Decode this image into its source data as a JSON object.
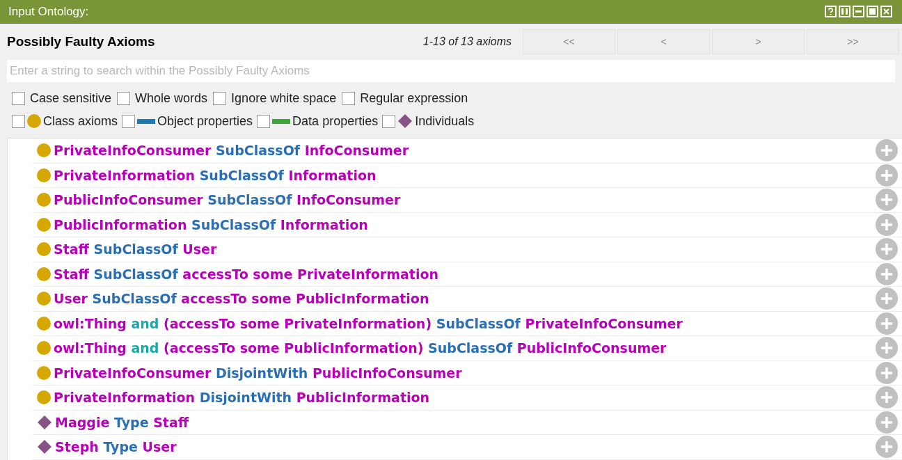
{
  "window": {
    "title": "Input Ontology:"
  },
  "header": {
    "title": "Possibly Faulty Axioms",
    "count": "1-13 of 13 axioms"
  },
  "pager": [
    {
      "label": "<<",
      "disabled": true
    },
    {
      "label": "<",
      "disabled": true
    },
    {
      "label": ">",
      "disabled": true
    },
    {
      "label": ">>",
      "disabled": true
    }
  ],
  "search": {
    "placeholder": "Enter a string to search within the Possibly Faulty Axioms"
  },
  "options": [
    {
      "label": "Case sensitive",
      "checked": false
    },
    {
      "label": "Whole words",
      "checked": false
    },
    {
      "label": "Ignore white space",
      "checked": false
    },
    {
      "label": "Regular expression",
      "checked": false
    }
  ],
  "filters": [
    {
      "label": "Class axioms",
      "kind": "class",
      "checked": false
    },
    {
      "label": "Object properties",
      "kind": "object",
      "checked": false
    },
    {
      "label": "Data properties",
      "kind": "data",
      "checked": false
    },
    {
      "label": "Individuals",
      "kind": "individual",
      "checked": false
    }
  ],
  "axioms": [
    {
      "kind": "class",
      "tokens": [
        {
          "text": "PrivateInfoConsumer",
          "kind": "entity"
        },
        {
          "text": "SubClassOf",
          "kind": "keyword"
        },
        {
          "text": "InfoConsumer",
          "kind": "entity"
        }
      ]
    },
    {
      "kind": "class",
      "tokens": [
        {
          "text": "PrivateInformation",
          "kind": "entity"
        },
        {
          "text": "SubClassOf",
          "kind": "keyword"
        },
        {
          "text": "Information",
          "kind": "entity"
        }
      ]
    },
    {
      "kind": "class",
      "tokens": [
        {
          "text": "PublicInfoConsumer",
          "kind": "entity"
        },
        {
          "text": "SubClassOf",
          "kind": "keyword"
        },
        {
          "text": "InfoConsumer",
          "kind": "entity"
        }
      ]
    },
    {
      "kind": "class",
      "tokens": [
        {
          "text": "PublicInformation",
          "kind": "entity"
        },
        {
          "text": "SubClassOf",
          "kind": "keyword"
        },
        {
          "text": "Information",
          "kind": "entity"
        }
      ]
    },
    {
      "kind": "class",
      "tokens": [
        {
          "text": "Staff",
          "kind": "entity"
        },
        {
          "text": "SubClassOf",
          "kind": "keyword"
        },
        {
          "text": "User",
          "kind": "entity"
        }
      ]
    },
    {
      "kind": "class",
      "tokens": [
        {
          "text": "Staff",
          "kind": "entity"
        },
        {
          "text": "SubClassOf",
          "kind": "keyword"
        },
        {
          "text": "accessTo some PrivateInformation",
          "kind": "entity"
        }
      ]
    },
    {
      "kind": "class",
      "tokens": [
        {
          "text": "User",
          "kind": "entity"
        },
        {
          "text": "SubClassOf",
          "kind": "keyword"
        },
        {
          "text": "accessTo some PublicInformation",
          "kind": "entity"
        }
      ]
    },
    {
      "kind": "class",
      "tokens": [
        {
          "text": "owl:Thing",
          "kind": "entity"
        },
        {
          "text": "and",
          "kind": "operator"
        },
        {
          "text": "(accessTo some PrivateInformation)",
          "kind": "entity"
        },
        {
          "text": "SubClassOf",
          "kind": "keyword"
        },
        {
          "text": "PrivateInfoConsumer",
          "kind": "entity"
        }
      ]
    },
    {
      "kind": "class",
      "tokens": [
        {
          "text": "owl:Thing",
          "kind": "entity"
        },
        {
          "text": "and",
          "kind": "operator"
        },
        {
          "text": "(accessTo some PublicInformation)",
          "kind": "entity"
        },
        {
          "text": "SubClassOf",
          "kind": "keyword"
        },
        {
          "text": "PublicInfoConsumer",
          "kind": "entity"
        }
      ]
    },
    {
      "kind": "class",
      "tokens": [
        {
          "text": "PrivateInfoConsumer",
          "kind": "entity"
        },
        {
          "text": "DisjointWith",
          "kind": "keyword"
        },
        {
          "text": "PublicInfoConsumer",
          "kind": "entity"
        }
      ]
    },
    {
      "kind": "class",
      "tokens": [
        {
          "text": "PrivateInformation",
          "kind": "entity"
        },
        {
          "text": "DisjointWith",
          "kind": "keyword"
        },
        {
          "text": "PublicInformation",
          "kind": "entity"
        }
      ]
    },
    {
      "kind": "individual",
      "tokens": [
        {
          "text": "Maggie",
          "kind": "entity"
        },
        {
          "text": "Type",
          "kind": "keyword"
        },
        {
          "text": "Staff",
          "kind": "entity"
        }
      ]
    },
    {
      "kind": "individual",
      "tokens": [
        {
          "text": "Steph",
          "kind": "entity"
        },
        {
          "text": "Type",
          "kind": "keyword"
        },
        {
          "text": "User",
          "kind": "entity"
        }
      ]
    }
  ]
}
